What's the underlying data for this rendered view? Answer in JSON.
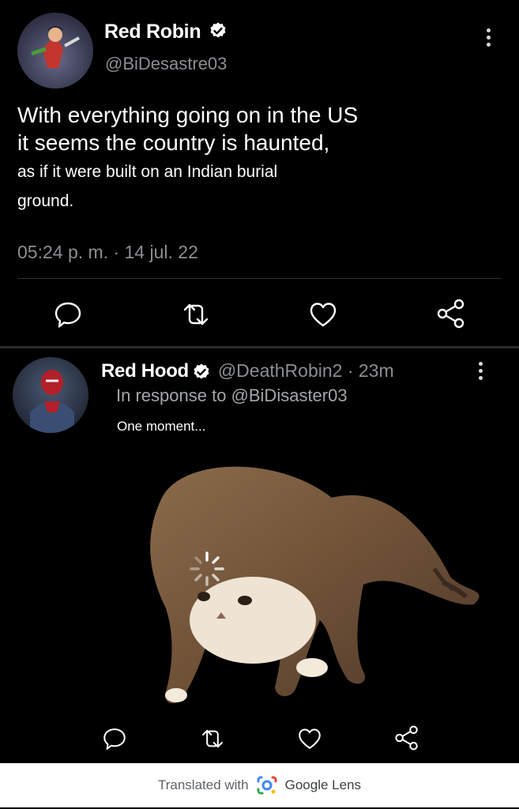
{
  "tweet": {
    "author_name": "Red Robin",
    "handle": "@BiDesastre03",
    "body_line1": "With everything going on in the US",
    "body_line2": "it seems the country is haunted,",
    "body_line3": "as if it were built on an Indian burial",
    "body_line4": "ground.",
    "timestamp": "05:24 p. m. · 14 jul. 22"
  },
  "reply": {
    "author_name": "Red Hood",
    "handle_time": "@DeathRobin2 · 23m",
    "in_response_to": "In response to @BiDisaster03",
    "text": "One moment..."
  },
  "footer": {
    "translated_with": "Translated with",
    "brand": "Google Lens"
  },
  "colors": {
    "background": "#000000",
    "muted_text": "#8b8e93",
    "divider": "#2f3336"
  },
  "icons": [
    "reply-icon",
    "retweet-icon",
    "like-icon",
    "share-icon",
    "more-icon",
    "verified-badge-icon",
    "google-lens-icon"
  ]
}
